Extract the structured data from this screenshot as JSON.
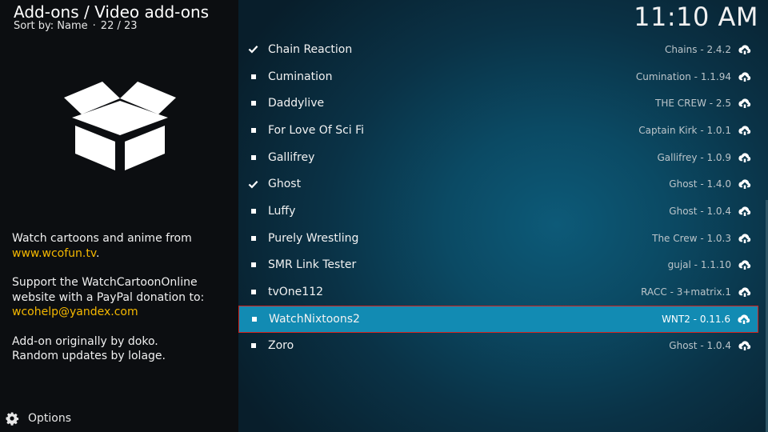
{
  "header": {
    "breadcrumb": "Add-ons / Video add-ons",
    "sort_label": "Sort by: Name",
    "separator": "·",
    "position": "22 / 23",
    "clock": "11:10 AM"
  },
  "sidebar": {
    "icon": "open-box-icon",
    "description": {
      "line1": "Watch cartoons and anime from",
      "link1": "www.wcofun.tv",
      "link1_suffix": ".",
      "line2": "Support the WatchCartoonOnline website with a PayPal donation to:",
      "email": "wcohelp@yandex.com",
      "line3": "Add-on originally by doko.",
      "line4": "Random updates by lolage."
    },
    "options_label": "Options",
    "options_icon": "gear-icon"
  },
  "addons": [
    {
      "name": "Chain Reaction",
      "version": "Chains - 2.4.2",
      "installed": true
    },
    {
      "name": "Cumination",
      "version": "Cumination - 1.1.94",
      "installed": false
    },
    {
      "name": "Daddylive",
      "version": "THE CREW - 2.5",
      "installed": false
    },
    {
      "name": "For Love Of Sci Fi",
      "version": "Captain Kirk - 1.0.1",
      "installed": false
    },
    {
      "name": "Gallifrey",
      "version": "Gallifrey - 1.0.9",
      "installed": false
    },
    {
      "name": "Ghost",
      "version": "Ghost - 1.4.0",
      "installed": true
    },
    {
      "name": "Luffy",
      "version": "Ghost - 1.0.4",
      "installed": false
    },
    {
      "name": "Purely Wrestling",
      "version": "The Crew - 1.0.3",
      "installed": false
    },
    {
      "name": "SMR Link Tester",
      "version": "gujal - 1.1.10",
      "installed": false
    },
    {
      "name": "tvOne112",
      "version": "RACC - 3+matrix.1",
      "installed": false
    },
    {
      "name": "WatchNixtoons2",
      "version": "WNT2 - 0.11.6",
      "installed": false,
      "selected": true
    },
    {
      "name": "Zoro",
      "version": "Ghost - 1.0.4",
      "installed": false
    }
  ],
  "colors": {
    "accent": "#f5b800",
    "selection": "#128bb3",
    "selection_border": "#d4231f"
  }
}
